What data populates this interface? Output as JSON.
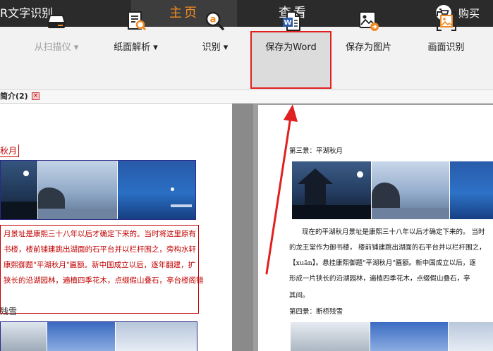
{
  "app": {
    "title": "R文字识别"
  },
  "tabs": [
    {
      "label": "主页"
    },
    {
      "label": "查看"
    }
  ],
  "buy": {
    "label": "购买"
  },
  "toolbar": {
    "scan_label": "从扫描仪",
    "parse_label": "纸面解析",
    "ocr_label": "识别",
    "save_word_label": "保存为Word",
    "save_image_label": "保存为图片",
    "region_ocr_label": "画面识别"
  },
  "doc_tab": {
    "label": "简介(2)"
  },
  "left_page": {
    "heading1": "秋月",
    "paragraph": [
      "月景址是康熙三十八年以后才确定下来的。当时将这里原有",
      "书楼，楼前铺建跳出湖面的石平台并以栏杆围之，旁构水轩",
      "康熙御题\"平湖秋月\"匾额。新中国成立以后，逐年翻建，扩",
      "狭长的沿湖园林，遍植四季花木，点缀假山叠石，亭台楼阁错"
    ],
    "heading2": "残雪"
  },
  "right_page": {
    "scene3_title": "第三景：平湖秋月",
    "paragraph": [
      "现在的平湖秋月景址是康熙三十八年以后才确定下来的。 当时",
      "的龙王堂作为御书楼，  楼前铺建跳出湖面的石平台并以栏杆围之，",
      "【xuān】。悬挂康熙御题\"平湖秋月\"匾额。新中国成立以后，逐",
      "形成一片狭长的沿湖园林，遍植四季花木，点缀假山叠石，亭",
      "其间。"
    ],
    "scene4_title": "第四景：断桥残雪"
  },
  "colors": {
    "accent": "#f08a24",
    "highlight": "#e02020",
    "topbar": "#2b2b2b"
  }
}
